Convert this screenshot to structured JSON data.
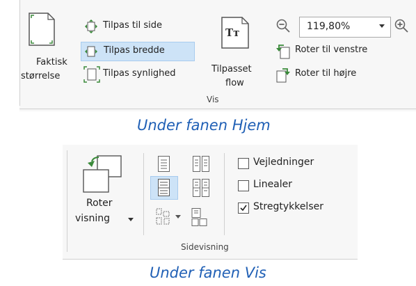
{
  "top_ribbon": {
    "actual_size": {
      "line1": "Faktisk",
      "line2": "størrelse"
    },
    "fit_page": "Tilpas til side",
    "fit_width": "Tilpas bredde",
    "fit_visibility": "Tilpas synlighed",
    "reflow": {
      "icon_text": "Tт",
      "line1": "Tilpasset",
      "line2": "flow"
    },
    "zoom_value": "119,80%",
    "rotate_left": "Roter til venstre",
    "rotate_right": "Roter til højre",
    "group_label": "Vis"
  },
  "caption_top": "Under fanen Hjem",
  "bottom_ribbon": {
    "rotate_view": {
      "line1": "Roter",
      "line2": "visning"
    },
    "checkboxes": [
      {
        "label": "Vejledninger",
        "checked": false
      },
      {
        "label": "Linealer",
        "checked": false
      },
      {
        "label": "Stregtykkelser",
        "checked": true
      }
    ],
    "group_label": "Sidevisning"
  },
  "caption_bottom": "Under fanen Vis",
  "colors": {
    "accent": "#1f5fb5",
    "highlight": "#cde3f7",
    "icon_green": "#3a8a3a"
  }
}
